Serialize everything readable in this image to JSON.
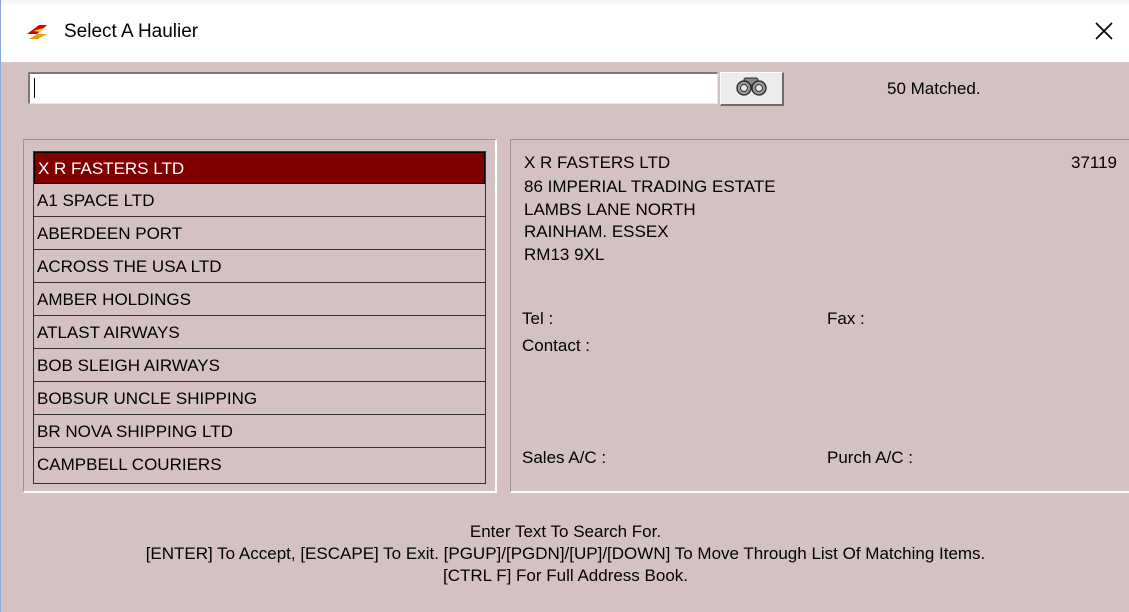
{
  "window": {
    "title": "Select A Haulier"
  },
  "search": {
    "value": "",
    "matched": "50 Matched."
  },
  "list": {
    "items": [
      "X R FASTERS LTD",
      "A1 SPACE LTD",
      "ABERDEEN PORT",
      "ACROSS THE USA LTD",
      "AMBER HOLDINGS",
      "ATLAST AIRWAYS",
      "BOB SLEIGH AIRWAYS",
      "BOBSUR UNCLE SHIPPING",
      "BR NOVA SHIPPING LTD",
      "CAMPBELL COURIERS"
    ],
    "selected_index": 0
  },
  "detail": {
    "name": "X R FASTERS LTD",
    "code": "37119",
    "address": [
      "86 IMPERIAL TRADING ESTATE",
      "LAMBS LANE NORTH",
      "RAINHAM. ESSEX",
      "RM13 9XL"
    ],
    "tel_label": "Tel :",
    "fax_label": "Fax :",
    "contact_label": "Contact :",
    "sales_label": "Sales A/C :",
    "purch_label": "Purch A/C :"
  },
  "help": {
    "lines": [
      "Enter Text To Search For.",
      "[ENTER] To Accept, [ESCAPE] To Exit. [PGUP]/[PGDN]/[UP]/[DOWN] To Move Through List Of Matching Items.",
      "[CTRL F] For Full Address Book."
    ]
  },
  "colors": {
    "background": "#d4c2c2",
    "selected": "#800000"
  },
  "icons": {
    "app": "truck-logo-icon",
    "search": "binoculars-icon",
    "close": "close-icon"
  }
}
